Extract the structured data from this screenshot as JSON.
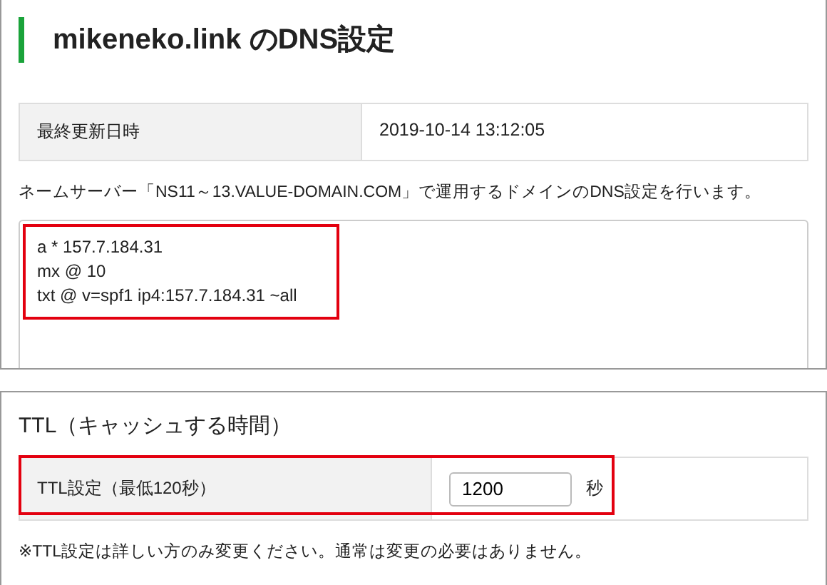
{
  "page_title": "mikeneko.link のDNS設定",
  "info_table": {
    "label": "最終更新日時",
    "value": "2019-10-14 13:12:05"
  },
  "description": "ネームサーバー「NS11～13.VALUE-DOMAIN.COM」で運用するドメインのDNS設定を行います。",
  "records": [
    "a * 157.7.184.31",
    "mx @ 10",
    "txt @ v=spf1 ip4:157.7.184.31 ~all"
  ],
  "ttl_section": {
    "title": "TTL（キャッシュする時間）",
    "label": "TTL設定（最低120秒）",
    "value": "1200",
    "unit": "秒",
    "note": "※TTL設定は詳しい方のみ変更ください。通常は変更の必要はありません。"
  }
}
